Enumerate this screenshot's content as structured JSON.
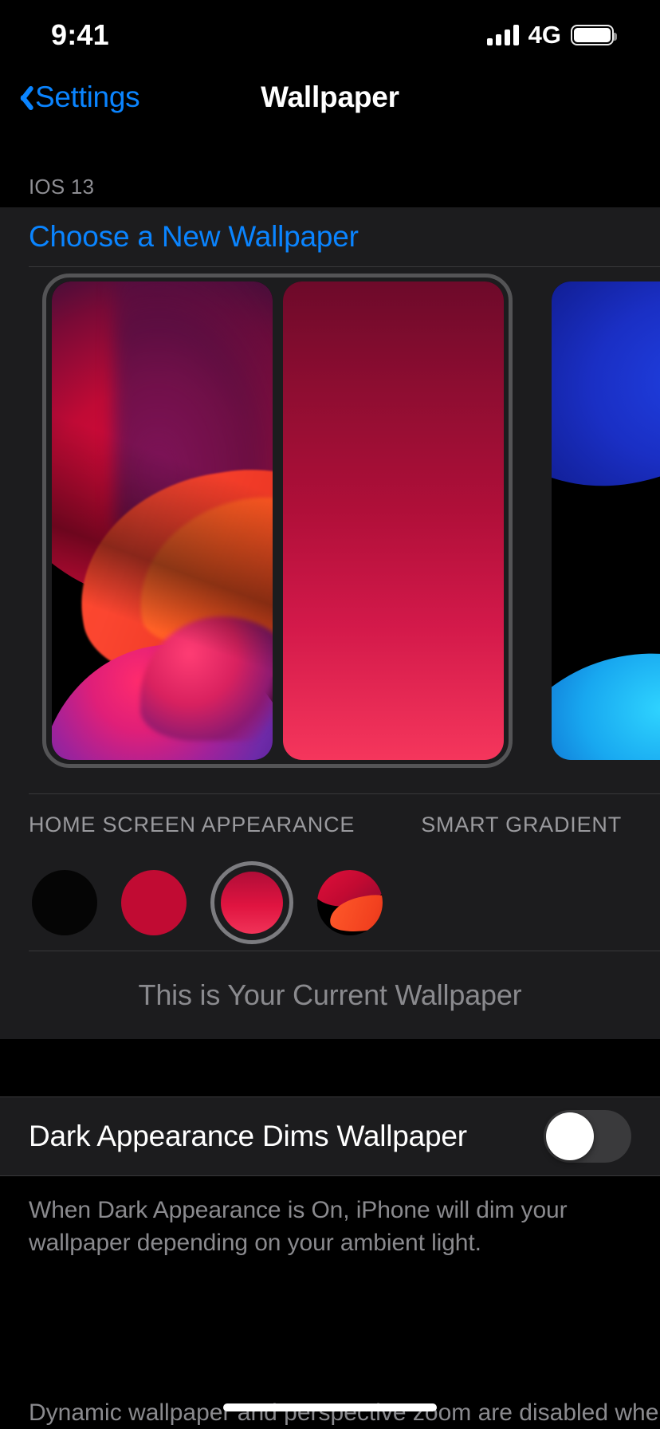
{
  "status_bar": {
    "time": "9:41",
    "network": "4G",
    "signal_icon": "cellular-bars-icon",
    "battery_icon": "battery-full-icon"
  },
  "nav": {
    "back_label": "Settings",
    "back_icon": "chevron-left-icon",
    "title": "Wallpaper"
  },
  "sections": {
    "group_header": "IOS 13",
    "choose_new_wallpaper": "Choose a New Wallpaper"
  },
  "preview": {
    "lock_screen_name": "lock-screen-preview",
    "home_screen_name": "home-screen-preview",
    "next_wallpaper_name": "next-wallpaper-preview",
    "lock_label": "",
    "appearance_label": "HOME SCREEN APPEARANCE",
    "gradient_label": "SMART GRADIENT",
    "current_wallpaper_text": "This is Your Current Wallpaper"
  },
  "swatches": [
    {
      "name": "swatch-black",
      "color": "#050505",
      "selected": false,
      "type": "solid"
    },
    {
      "name": "swatch-crimson",
      "color": "#c10b33",
      "selected": false,
      "type": "solid"
    },
    {
      "name": "swatch-red",
      "color": "#e01440",
      "selected": true,
      "type": "gradient"
    },
    {
      "name": "swatch-image",
      "color": "#ef3a22",
      "selected": false,
      "type": "image"
    }
  ],
  "dark_appearance": {
    "label": "Dark Appearance Dims Wallpaper",
    "toggle_state": "off",
    "toggle_name": "dark-appearance-dims-wallpaper-toggle",
    "description": "When Dark Appearance is On, iPhone will dim your wallpaper depending on your ambient light.",
    "description_2": "Dynamic wallpaper and perspective zoom are disabled when Low"
  },
  "colors": {
    "accent_blue": "#0a84ff",
    "panel": "#1c1c1e",
    "separator": "#38383a",
    "secondary_text": "#8e8e93",
    "background": "#000000",
    "swatch_ring": "#7c7c80",
    "frame_border": "#545456",
    "gradient_top": "#6d0a2a",
    "gradient_bottom": "#f5365c"
  }
}
